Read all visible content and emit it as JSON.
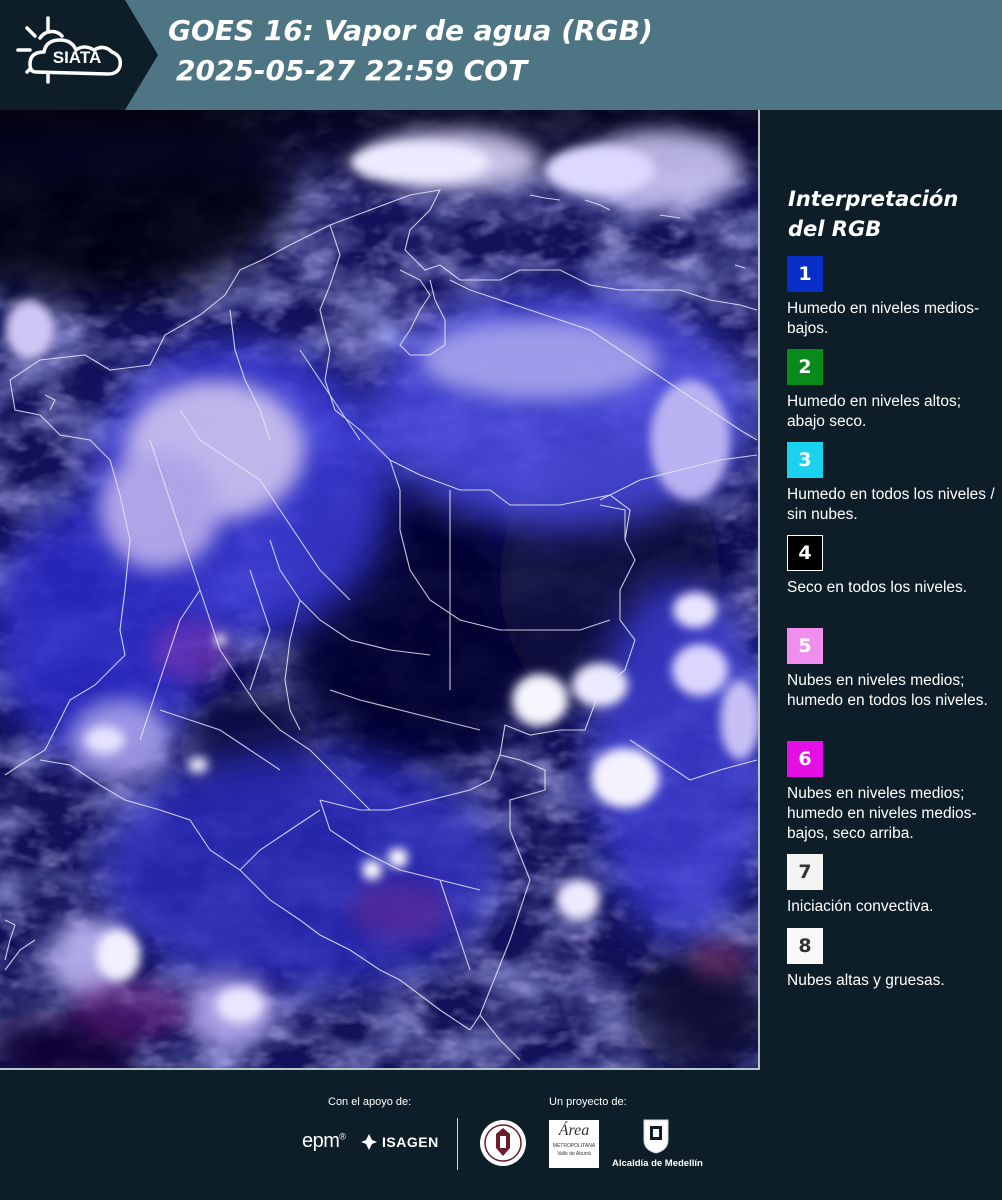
{
  "header": {
    "logo_text": "SIATA",
    "title_line1": "GOES 16: Vapor de agua (RGB)",
    "title_line2": "2025-05-27 22:59 COT"
  },
  "map": {
    "icon": "satellite-water-vapor-rgb-map"
  },
  "legend": {
    "title": "Interpretación del RGB",
    "items": [
      {
        "number": "1",
        "color": "#0a2fc8",
        "text_color": "#ffffff",
        "text": "Humedo en niveles medios-bajos."
      },
      {
        "number": "2",
        "color": "#0a8a1a",
        "text_color": "#ffffff",
        "text": "Humedo en niveles altos; abajo seco."
      },
      {
        "number": "3",
        "color": "#1ad2ee",
        "text_color": "#ffffff",
        "text": "Humedo en todos los niveles / sin nubes."
      },
      {
        "number": "4",
        "color": "#000000",
        "text_color": "#ffffff",
        "text": "Seco en todos los niveles."
      },
      {
        "number": "5",
        "color": "#f08ef0",
        "text_color": "#ffffff",
        "text": "Nubes en niveles medios; humedo en todos los niveles."
      },
      {
        "number": "6",
        "color": "#e40fe4",
        "text_color": "#ffffff",
        "text": "Nubes en niveles medios; humedo en niveles medios-bajos, seco arriba."
      },
      {
        "number": "7",
        "color": "#f4f4f4",
        "text_color": "#333333",
        "text": "Iniciación convectiva."
      },
      {
        "number": "8",
        "color": "#f8f8f8",
        "text_color": "#333333",
        "text": "Nubes altas y gruesas."
      }
    ]
  },
  "footer": {
    "support_label": "Con el apoyo de:",
    "project_label": "Un proyecto de:",
    "sponsor_epm": "epm",
    "sponsor_isagen": "ISAGEN",
    "area_logo_text": "Área",
    "area_logo_sub": "METROPOLITANA",
    "area_logo_sub2": "Valle de Aburrá",
    "alcaldia": "Alcaldía de Medellín"
  }
}
